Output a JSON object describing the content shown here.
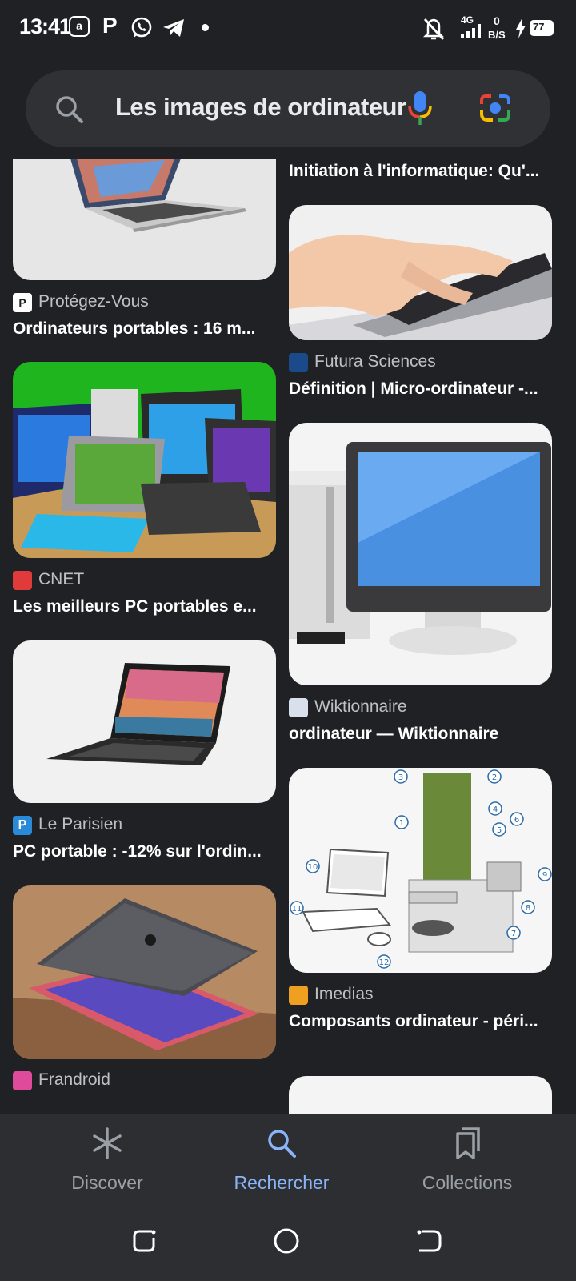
{
  "status_bar": {
    "time": "13:41",
    "network": "4G",
    "data_rate_top": "0",
    "data_rate_bottom": "B/S",
    "battery": "77"
  },
  "search": {
    "query": "Les images de ordinateur"
  },
  "results_left": [
    {
      "source": "Protégez-Vous",
      "title": "Ordinateurs portables : 16 m..."
    },
    {
      "source": "CNET",
      "title": "Les meilleurs PC portables e..."
    },
    {
      "source": "Le Parisien",
      "title": "PC portable : -12% sur l'ordin..."
    },
    {
      "source": "Frandroid",
      "title": ""
    }
  ],
  "results_right": [
    {
      "source": "",
      "title": "Initiation à l'informatique: Qu'..."
    },
    {
      "source": "Futura Sciences",
      "title": "Définition | Micro-ordinateur -..."
    },
    {
      "source": "Wiktionnaire",
      "title": "ordinateur — Wiktionnaire"
    },
    {
      "source": "Imedias",
      "title": "Composants ordinateur - péri..."
    }
  ],
  "diagram_labels": [
    "1",
    "2",
    "3",
    "4",
    "5",
    "6",
    "7",
    "8",
    "9",
    "10",
    "11",
    "12"
  ],
  "bottom_nav": {
    "discover": "Discover",
    "search": "Rechercher",
    "collections": "Collections"
  },
  "colors": {
    "background": "#202124",
    "search_bar": "#303134",
    "active_nav": "#8ab4f8",
    "inactive_nav": "#9aa0a6"
  }
}
